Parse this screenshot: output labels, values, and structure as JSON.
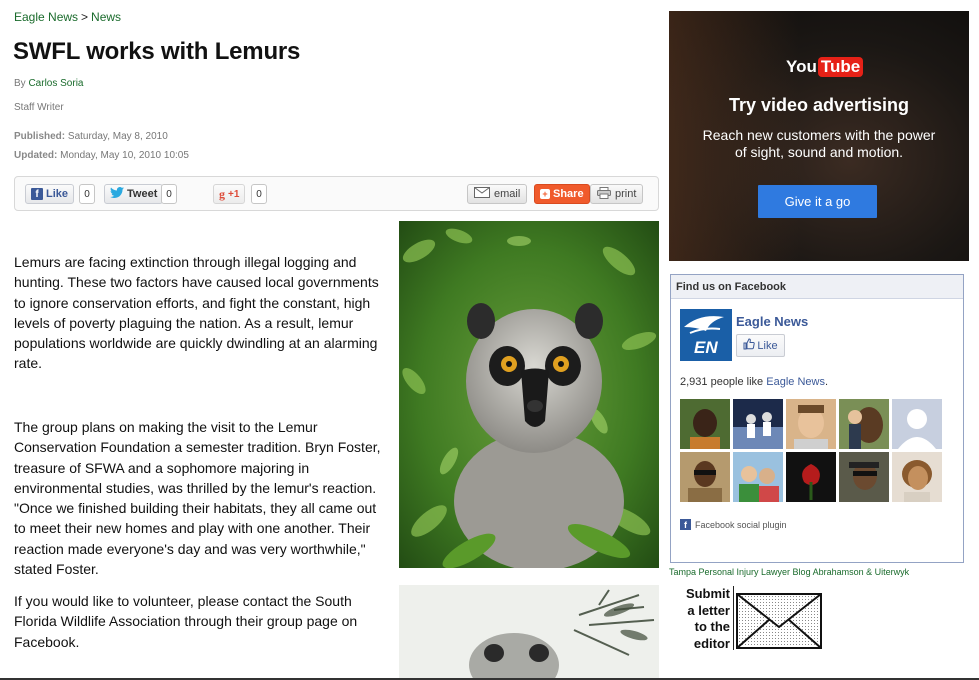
{
  "breadcrumb": {
    "home": "Eagle News",
    "separator": ">",
    "section": "News"
  },
  "article": {
    "title": "SWFL works with Lemurs",
    "byline_prefix": "By",
    "author": "Carlos Soria",
    "role": "Staff Writer",
    "published_label": "Published:",
    "published_value": "Saturday, May 8, 2010",
    "updated_label": "Updated:",
    "updated_value": "Monday, May 10, 2010 10:05",
    "paragraphs": [
      "Lemurs are facing extinction through illegal logging and hunting. These two factors have caused local governments to ignore conservation efforts, and fight the constant, high levels of poverty plaguing the nation. As a result, lemur populations worldwide are quickly dwindling at an alarming rate.",
      "The group plans on making the visit to the Lemur Conservation Foundation a semester tradition. Bryn Foster, treasure of SFWA and a sophomore majoring in environmental studies, was thrilled by the lemur's reaction. \"Once we finished building their habitats, they all came out to meet their new homes and play with one another. Their reaction made everyone's day and was very worthwhile,\" stated Foster.",
      "If you would like to volunteer, please contact the South Florida Wildlife Association through their group page on Facebook."
    ]
  },
  "share_bar": {
    "fb_like_label": "Like",
    "fb_like_count": "0",
    "tweet_label": "Tweet",
    "tweet_count": "0",
    "gplus_label": "+1",
    "gplus_count": "0",
    "email_label": "email",
    "share_label": "Share",
    "print_label": "print"
  },
  "ad": {
    "brand_you": "You",
    "brand_tube": "Tube",
    "headline": "Try video advertising",
    "subtext": "Reach new customers with the power of sight, sound and motion.",
    "cta": "Give it a go"
  },
  "facebook_box": {
    "header": "Find us on Facebook",
    "logo_text": "EN",
    "page_name": "Eagle News",
    "like_label": "Like",
    "count_prefix": "2,931 people like",
    "count_link": "Eagle News",
    "count_suffix": ".",
    "plugin_label": "Facebook social plugin"
  },
  "sidebar": {
    "law_link": "Tampa Personal Injury Lawyer Blog Abrahamson & Uiterwyk",
    "submit_letter": [
      "Submit",
      "a letter",
      "to the",
      "editor"
    ]
  },
  "colors": {
    "link_green": "#1a6b2c",
    "facebook_blue": "#3b5998",
    "share_orange": "#f05a2b",
    "youtube_red": "#e62117",
    "ad_cta_blue": "#2f7ae0"
  },
  "icons": [
    "facebook-icon",
    "twitter-icon",
    "google-plus-icon",
    "email-icon",
    "share-plus-icon",
    "print-icon",
    "thumbs-up-icon",
    "envelope-icon"
  ]
}
